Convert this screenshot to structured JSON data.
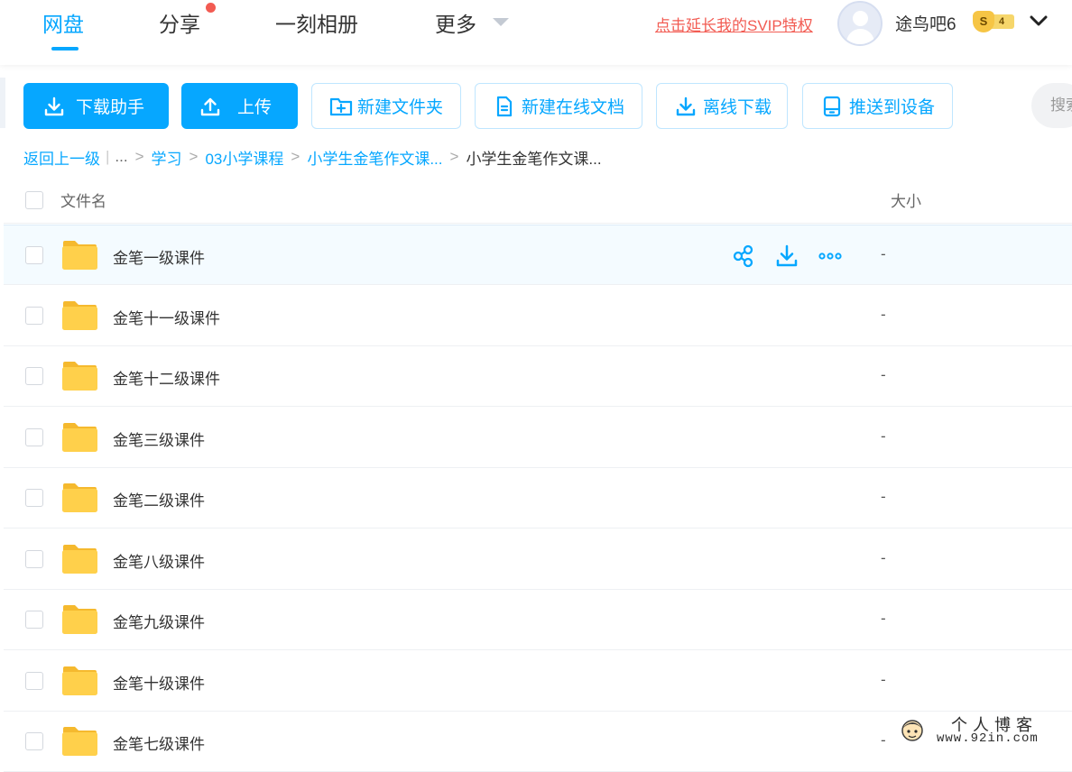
{
  "nav": {
    "tabs": [
      {
        "label": "网盘",
        "active": true
      },
      {
        "label": "分享",
        "active": false,
        "has_badge_dot": true
      },
      {
        "label": "一刻相册",
        "active": false
      },
      {
        "label": "更多",
        "active": false,
        "has_dropdown": true
      }
    ],
    "svip_link": "点击延长我的SVIP特权",
    "user": {
      "name": "途鸟吧6",
      "vip_symbol": "S",
      "vip_level": "4"
    }
  },
  "toolbar": {
    "download_helper": "下载助手",
    "upload": "上传",
    "new_folder": "新建文件夹",
    "new_online_doc": "新建在线文档",
    "offline_download": "离线下载",
    "push_to_device": "推送到设备",
    "search_placeholder": "搜索"
  },
  "breadcrumb": {
    "back": "返回上一级",
    "ellipsis": "...",
    "items": [
      "学习",
      "03小学课程",
      "小学生金笔作文课..."
    ],
    "current": "小学生金笔作文课..."
  },
  "table": {
    "columns": {
      "name": "文件名",
      "size": "大小"
    },
    "rows": [
      {
        "name": "金笔一级课件",
        "size": "-",
        "hover": true
      },
      {
        "name": "金笔十一级课件",
        "size": "-"
      },
      {
        "name": "金笔十二级课件",
        "size": "-"
      },
      {
        "name": "金笔三级课件",
        "size": "-"
      },
      {
        "name": "金笔二级课件",
        "size": "-"
      },
      {
        "name": "金笔八级课件",
        "size": "-"
      },
      {
        "name": "金笔九级课件",
        "size": "-"
      },
      {
        "name": "金笔十级课件",
        "size": "-"
      },
      {
        "name": "金笔七级课件",
        "size": "-"
      }
    ]
  },
  "watermark": {
    "line1": "个人博客",
    "line2": "www.92in.com"
  },
  "colors": {
    "accent": "#06a7ff",
    "folder": "#ffd04b",
    "alert": "#f25b52"
  },
  "icons": {
    "download_helper": "download-icon",
    "upload": "upload-icon",
    "new_folder": "folder-plus-icon",
    "new_online_doc": "document-icon",
    "offline_download": "download-icon",
    "push_to_device": "device-icon",
    "row_share": "share-icon",
    "row_download": "download-icon",
    "row_more": "more-icon"
  }
}
